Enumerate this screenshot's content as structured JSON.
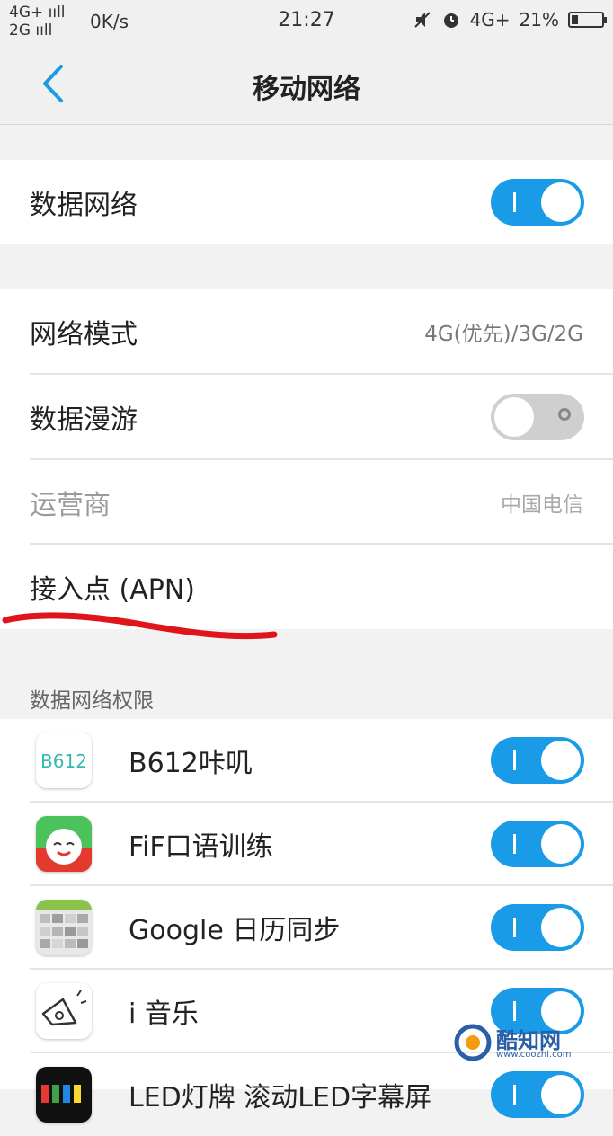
{
  "status_bar": {
    "network_top": "4G+ ııll",
    "network_bottom": "2G ııll",
    "speed": "0K/s",
    "time": "21:27",
    "network_right": "4G+",
    "battery_text": "21%",
    "battery_level": 0.21
  },
  "nav": {
    "title": "移动网络"
  },
  "settings": {
    "data_network": {
      "label": "数据网络",
      "enabled": true
    },
    "network_mode": {
      "label": "网络模式",
      "value": "4G(优先)/3G/2G"
    },
    "data_roaming": {
      "label": "数据漫游",
      "enabled": false
    },
    "carrier": {
      "label": "运营商",
      "value": "中国电信"
    },
    "apn": {
      "label": "接入点 (APN)"
    }
  },
  "permissions": {
    "header": "数据网络权限",
    "apps": [
      {
        "name": "B612咔叽",
        "icon": "b612-app-icon",
        "icon_text": "B612",
        "enabled": true
      },
      {
        "name": "FiF口语训练",
        "icon": "fif-app-icon",
        "enabled": true
      },
      {
        "name": "Google 日历同步",
        "icon": "google-calendar-app-icon",
        "enabled": true
      },
      {
        "name": "i 音乐",
        "icon": "i-music-app-icon",
        "enabled": true
      },
      {
        "name": "LED灯牌  滚动LED字幕屏",
        "icon": "led-app-icon",
        "enabled": true
      }
    ]
  },
  "watermark": {
    "text": "酷知网",
    "url": "www.coozhi.com"
  },
  "colors": {
    "toggle_on": "#1a9be8",
    "toggle_off": "#cfcfcf",
    "back_arrow": "#1a9be8",
    "annotation": "#e0141b"
  }
}
